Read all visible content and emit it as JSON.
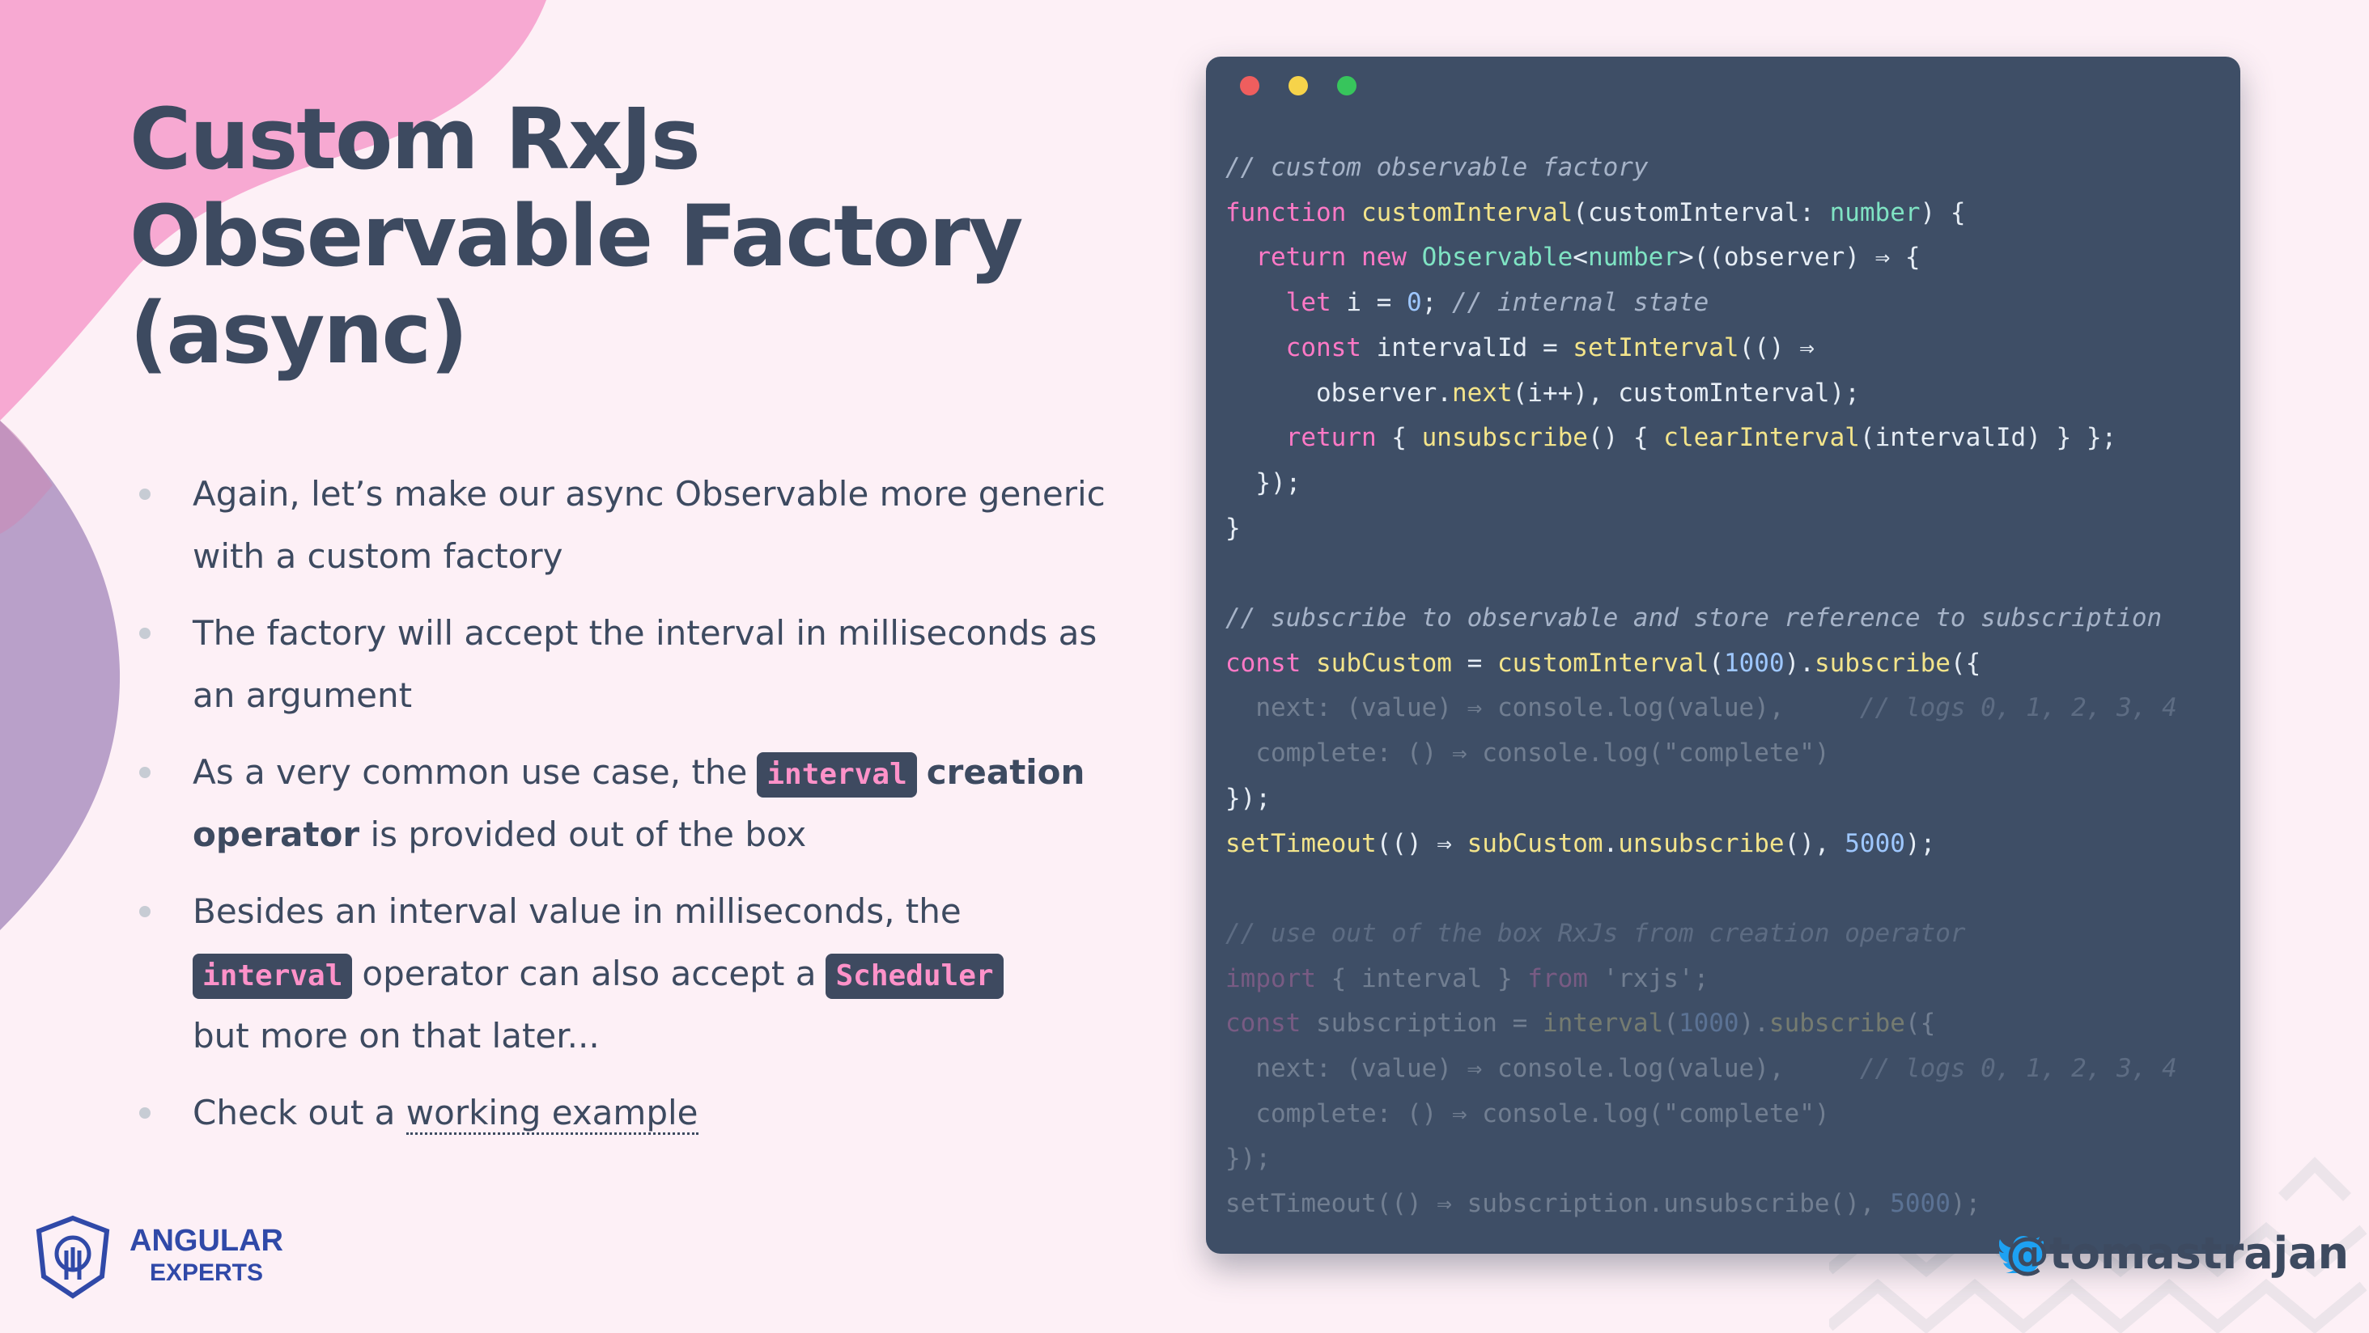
{
  "title": {
    "line1": "Custom RxJs",
    "line2": "Observable Factory",
    "line3": "(async)"
  },
  "bullets": {
    "b1": "Again, let’s make our async Observable more generic with a custom factory",
    "b2": "The factory will accept the interval in milliseconds as an argument",
    "b3": {
      "pre": "As a very common use case, the",
      "code": "interval",
      "bold": "creation operator",
      "post": " is provided out of the box"
    },
    "b4": {
      "pre": "Besides an interval value in milliseconds, the",
      "code1": "interval",
      "mid": "operator can also accept a",
      "code2": "Scheduler",
      "post": "but more on that later..."
    },
    "b5": {
      "pre": "Check out a ",
      "link": "working example"
    }
  },
  "code_window": {
    "dots": [
      "#ef5e5e",
      "#f6d34a",
      "#37c55c"
    ]
  },
  "logo": {
    "line1": "ANGULAR",
    "line2": "EXPERTS"
  },
  "handle": "@tomastrajan",
  "colors": {
    "background": "#fdf0f6",
    "title": "#3d4a60",
    "code_bg": "#3e4e66",
    "pink_blob": "#f7a9d2",
    "purple_blob": "#b9a0c9",
    "accent_pink": "#ff92c9"
  },
  "icons": {
    "logo": "angular-experts-shield-icon",
    "twitter": "twitter-bird-icon"
  }
}
